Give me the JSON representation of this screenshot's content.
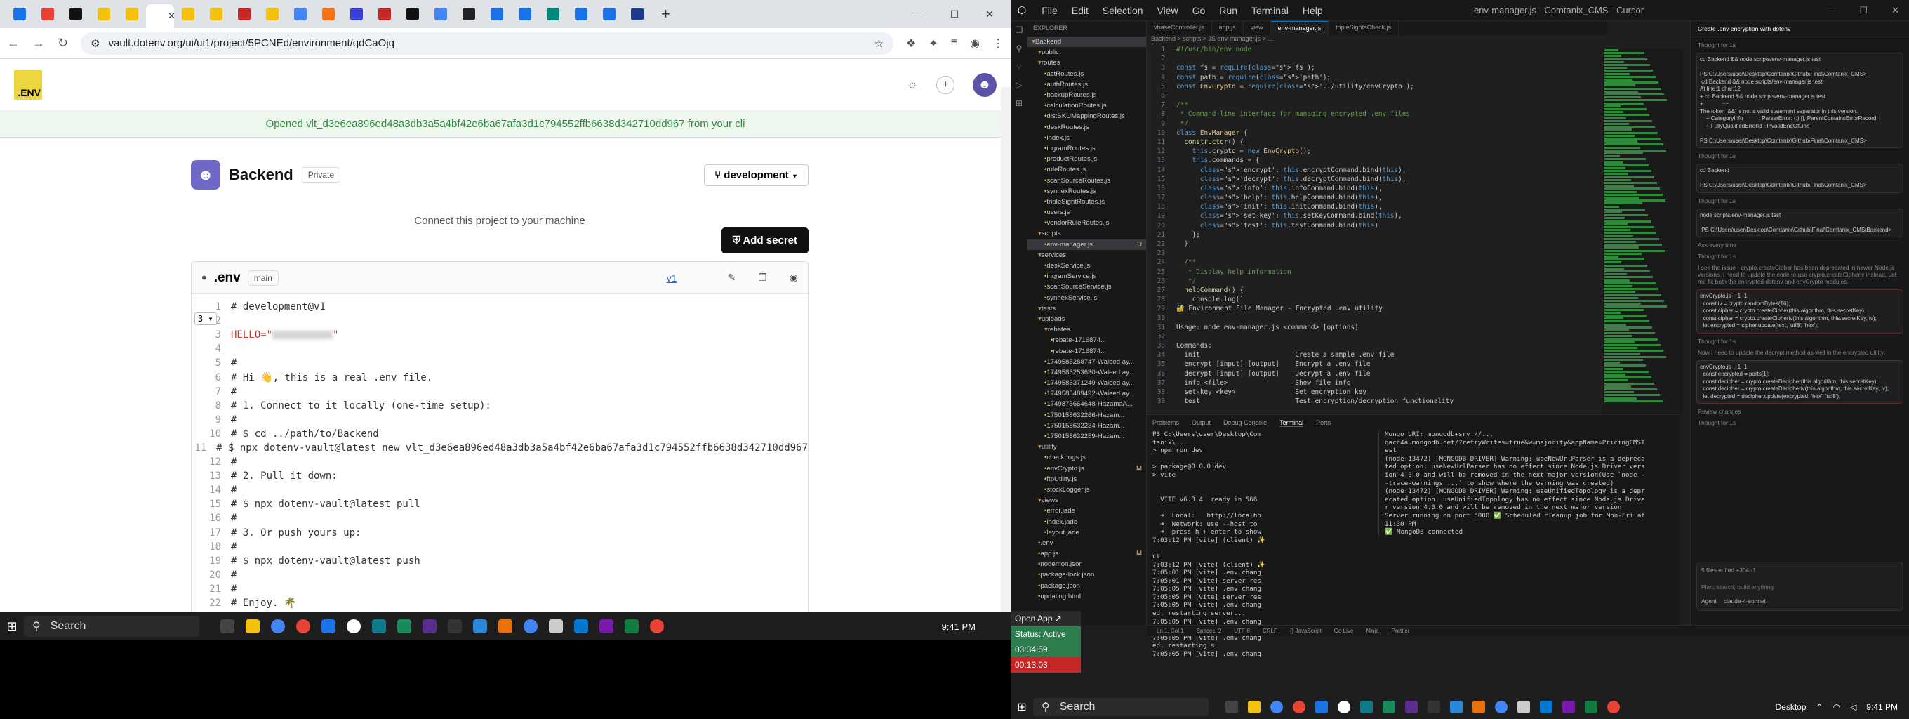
{
  "browser": {
    "tab_colors": [
      "#1a73e8",
      "#ea4335",
      "#111111",
      "#f4c20d",
      "#f4c20d",
      "#ffffff",
      "#f4c20d",
      "#f4c20d",
      "#c62828",
      "#f4c20d",
      "#4285f4",
      "#f97316",
      "#3b3fd8",
      "#c62828",
      "#111111",
      "#4285f4",
      "#222222",
      "#1a73e8",
      "#1a73e8",
      "#00897b",
      "#1a73e8",
      "#1a73e8",
      "#1e3a8a"
    ],
    "url": "vault.dotenv.org/ui/ui1/project/5PCNEd/environment/qdCaOjq"
  },
  "app": {
    "logo_text": ".ENV",
    "banner": "Opened vlt_d3e6ea896ed48a3db3a5a4bf42e6ba67afa3d1c794552ffb6638d342710dd967 from your cli",
    "project_name": "Backend",
    "visibility": "Private",
    "environment": "development",
    "connect_link": "Connect this project",
    "connect_suffix": " to your machine",
    "add_secret": "Add secret",
    "file_name": ".env",
    "branch": "main",
    "version": "v1",
    "fold_label": "3"
  },
  "env_lines": [
    {
      "no": "1",
      "text": "# development@v1"
    },
    {
      "no": "2",
      "text": ""
    },
    {
      "no": "3",
      "text": "HELLO=\"",
      "secret": true
    },
    {
      "no": "4",
      "text": ""
    },
    {
      "no": "5",
      "text": "#"
    },
    {
      "no": "6",
      "text": "# Hi 👋, this is a real .env file."
    },
    {
      "no": "7",
      "text": "#"
    },
    {
      "no": "8",
      "text": "# 1. Connect to it locally (one-time setup):"
    },
    {
      "no": "9",
      "text": "#"
    },
    {
      "no": "10",
      "text": "# $ cd ../path/to/Backend"
    },
    {
      "no": "11",
      "text": "# $ npx dotenv-vault@latest new vlt_d3e6ea896ed48a3db3a5a4bf42e6ba67afa3d1c794552ffb6638d342710dd967"
    },
    {
      "no": "12",
      "text": "#"
    },
    {
      "no": "13",
      "text": "# 2. Pull it down:"
    },
    {
      "no": "14",
      "text": "#"
    },
    {
      "no": "15",
      "text": "# $ npx dotenv-vault@latest pull"
    },
    {
      "no": "16",
      "text": "#"
    },
    {
      "no": "17",
      "text": "# 3. Or push yours up:"
    },
    {
      "no": "18",
      "text": "#"
    },
    {
      "no": "19",
      "text": "# $ npx dotenv-vault@latest push"
    },
    {
      "no": "20",
      "text": "#"
    },
    {
      "no": "21",
      "text": "#"
    },
    {
      "no": "22",
      "text": "# Enjoy. 🌴"
    }
  ],
  "taskbar_left": {
    "search": "Search",
    "clock": "9:41 PM"
  },
  "ide": {
    "menu": [
      "File",
      "Edit",
      "Selection",
      "View",
      "Go",
      "Run",
      "Terminal",
      "Help"
    ],
    "title": "env-manager.js - Comtanix_CMS - Cursor",
    "tabs": [
      "vbaseController.js",
      "app.js",
      "view",
      "env-manager.js",
      "tripleSightsCheck.js"
    ],
    "breadcrumb": "Backend > scripts > JS env-manager.js > ...",
    "explorer": [
      {
        "t": "Backend",
        "d": 0,
        "sel": true
      },
      {
        "t": "public",
        "d": 1
      },
      {
        "t": "routes",
        "d": 1
      },
      {
        "t": "actRoutes.js",
        "d": 2
      },
      {
        "t": "authRoutes.js",
        "d": 2
      },
      {
        "t": "backupRoutes.js",
        "d": 2
      },
      {
        "t": "calculationRoutes.js",
        "d": 2
      },
      {
        "t": "distSKUMappingRoutes.js",
        "d": 2
      },
      {
        "t": "deskRoutes.js",
        "d": 2
      },
      {
        "t": "index.js",
        "d": 2
      },
      {
        "t": "ingramRoutes.js",
        "d": 2
      },
      {
        "t": "productRoutes.js",
        "d": 2
      },
      {
        "t": "ruleRoutes.js",
        "d": 2
      },
      {
        "t": "scanSourceRoutes.js",
        "d": 2
      },
      {
        "t": "synnexRoutes.js",
        "d": 2
      },
      {
        "t": "tripleSightRoutes.js",
        "d": 2
      },
      {
        "t": "users.js",
        "d": 2
      },
      {
        "t": "vendorRuleRoutes.js",
        "d": 2
      },
      {
        "t": "scripts",
        "d": 1
      },
      {
        "t": "env-manager.js",
        "d": 2,
        "sel": true,
        "m": "U"
      },
      {
        "t": "services",
        "d": 1
      },
      {
        "t": "deskService.js",
        "d": 2
      },
      {
        "t": "ingramService.js",
        "d": 2
      },
      {
        "t": "scanSourceService.js",
        "d": 2
      },
      {
        "t": "synnexService.js",
        "d": 2
      },
      {
        "t": "tests",
        "d": 1
      },
      {
        "t": "uploads",
        "d": 1
      },
      {
        "t": "rebates",
        "d": 2
      },
      {
        "t": "rebate-1716874...",
        "d": 3
      },
      {
        "t": "rebate-1716874...",
        "d": 3
      },
      {
        "t": "1749585288747-Waleed ay...",
        "d": 2
      },
      {
        "t": "1749585253630-Waleed ay...",
        "d": 2
      },
      {
        "t": "1749585371249-Waleed ay...",
        "d": 2
      },
      {
        "t": "1749585489492-Waleed ay...",
        "d": 2
      },
      {
        "t": "1749875664648-HazamaA...",
        "d": 2
      },
      {
        "t": "1750158632266-Hazam...",
        "d": 2
      },
      {
        "t": "1750158632234-Hazam...",
        "d": 2
      },
      {
        "t": "1750158632259-Hazam...",
        "d": 2
      },
      {
        "t": "utility",
        "d": 1
      },
      {
        "t": "checkLogs.js",
        "d": 2
      },
      {
        "t": "envCrypto.js",
        "d": 2,
        "m": "M"
      },
      {
        "t": "ftpUtility.js",
        "d": 2
      },
      {
        "t": "stockLogger.js",
        "d": 2
      },
      {
        "t": "views",
        "d": 1
      },
      {
        "t": "error.jade",
        "d": 2
      },
      {
        "t": "index.jade",
        "d": 2
      },
      {
        "t": "layout.jade",
        "d": 2
      },
      {
        "t": ".env",
        "d": 1
      },
      {
        "t": "app.js",
        "d": 1,
        "m": "M"
      },
      {
        "t": "nodemon.json",
        "d": 1
      },
      {
        "t": "package-lock.json",
        "d": 1
      },
      {
        "t": "package.json",
        "d": 1
      },
      {
        "t": "updating.html",
        "d": 1
      }
    ],
    "code": [
      "#!/usr/bin/env node",
      "",
      "const fs = require('fs');",
      "const path = require('path');",
      "const EnvCrypto = require('../utility/envCrypto');",
      "",
      "/**",
      " * Command-line interface for managing encrypted .env files",
      " */",
      "class EnvManager {",
      "  constructor() {",
      "    this.crypto = new EnvCrypto();",
      "    this.commands = {",
      "      'encrypt': this.encryptCommand.bind(this),",
      "      'decrypt': this.decryptCommand.bind(this),",
      "      'info': this.infoCommand.bind(this),",
      "      'help': this.helpCommand.bind(this),",
      "      'init': this.initCommand.bind(this),",
      "      'set-key': this.setKeyCommand.bind(this),",
      "      'test': this.testCommand.bind(this)",
      "    };",
      "  }",
      "",
      "  /**",
      "   * Display help information",
      "   */",
      "  helpCommand() {",
      "    console.log(`",
      "🔐 Environment File Manager - Encrypted .env utility",
      "",
      "Usage: node env-manager.js <command> [options]",
      "",
      "Commands:",
      "  init                        Create a sample .env file",
      "  encrypt [input] [output]    Encrypt a .env file",
      "  decrypt [input] [output]    Decrypt a .env file",
      "  info <file>                 Show file info",
      "  set-key <key>               Set encryption key",
      "  test                        Test encryption/decryption functionality"
    ],
    "panel_tabs": [
      "Problems",
      "Output",
      "Debug Console",
      "Terminal",
      "Ports"
    ],
    "term_left": "PS C:\\Users\\user\\Desktop\\Com\ntanix\\...\n> npm run dev\n\n> package@0.0.0 dev\n> vite\n\n\n  VITE v6.3.4  ready in 566 \n\n  ➜  Local:   http://localho\n  ➜  Network: use --host to\n  ➜  press h + enter to show\n7:03:12 PM [vite] (client) ✨\n\nct\n7:03:12 PM [vite] (client) ✨\n7:05:01 PM [vite] .env chang\n7:05:01 PM [vite] server res\n7:05:05 PM [vite] .env chang\n7:05:05 PM [vite] server res\n7:05:05 PM [vite] .env chang\ned, restarting server...\n7:05:05 PM [vite] .env chang\ned, restarting server...\n7:05:05 PM [vite] .env chang\ned, restarting s\n7:05:05 PM [vite] .env chang",
    "term_right": "Mongo URI: mongodb+srv://...\nqacc4a.mongodb.net/?retryWrites=true&w=majority&appName=PricingCMST\nest\n(node:13472) [MONGODB DRIVER] Warning: useNewUrlParser is a depreca\nted option: useNewUrlParser has no effect since Node.js Driver vers\nion 4.0.0 and will be removed in the next major version(Use `node -\n-trace-warnings ...` to show where the warning was created)\n(node:13472) [MONGODB DRIVER] Warning: useUnifiedTopology is a depr\necated option: useUnifiedTopology has no effect since Node.js Drive\nr version 4.0.0 and will be removed in the next major version\nServer running on port 5000 ✅ Scheduled cleanup job for Mon-Fri at\n11:30 PM\n✅ MongoDB connected\n",
    "chat_title": "Create .env encryption with dotenv",
    "chat_blocks": [
      "cd Backend && node scripts/env-manager.js test\n\nPS C:\\Users\\user\\Desktop\\Comtanix\\Github\\Final\\Comtanix_CMS>\n cd Backend && node scripts/env-manager.js test\nAt line:1 char:12\n+ cd Backend && node scripts/env-manager.js test\n+            ~~\nThe token '&&' is not a valid statement separator in this version.\n    + CategoryInfo          : ParserError: (:) [], ParentContainsErrorRecord\n    + FullyQualifiedErrorId : InvalidEndOfLine\n\nPS C:\\Users\\user\\Desktop\\Comtanix\\Github\\Final\\Comtanix_CMS>",
      "cd Backend\n\nPS C:\\Users\\user\\Desktop\\Comtanix\\Github\\Final\\Comtanix_CMS>",
      "node scripts/env-manager.js test\n\n PS C:\\Users\\user\\Desktop\\Comtanix\\Github\\Final\\Comtanix_CMS\\Backend>"
    ],
    "chat_thoughts": [
      "Thought for 1s",
      "Thought for 1s",
      "Thought for 1s",
      "Thought for 1s",
      "Ask every time",
      "Thought for 1s",
      "I see the issue - crypto.createCipher has been deprecated in newer\nNode.js versions. I need to update the code to use crypto.createCipheriv\ninstead. Let me fix both the encrypted dotenv and envCrypto\nmodules.",
      "Thought for 1s",
      "Now I need to update the decrypt method as well in the encrypted\nutility:",
      "Review changes"
    ],
    "chat_diffs": [
      "envCrypto.js  +1 -1\n  const iv = crypto.randomBytes(16);\n  const cipher = crypto.createCipher(this.algorithm, this.secretKey);\n  const cipher = crypto.createCipheriv(this.algorithm, this.secretKey, iv);\n  let encrypted = cipher.update(text, 'utf8', 'hex');",
      "envCrypto.js  +1 -1\n  const encrypted = parts[1];\n  const decipher = crypto.createDecipher(this.algorithm, this.secretKey);\n  const decipher = crypto.createDecipheriv(this.algorithm, this.secretKey, iv);\n  let decrypted = decipher.update(encrypted, 'hex', 'utf8');"
    ],
    "chat_input": "Plan, search, build anything",
    "chat_footer": "5 files edited  +304  -1",
    "agent_mode": "Agent",
    "model": "claude-4-sonnet",
    "status": [
      "Ln 1, Col 1",
      "Spaces: 2",
      "UTF-8",
      "CRLF",
      "{} JavaScript",
      "Go Live",
      "Ninja",
      "Prettier"
    ],
    "widgets": [
      {
        "text": "Open App ↗",
        "color": "#2b2b2b"
      },
      {
        "text": "Status: Active",
        "color": "#2e7d4f"
      },
      {
        "text": "03:34:59",
        "color": "#2e7d4f"
      },
      {
        "text": "00:13:03",
        "color": "#c62828"
      }
    ]
  },
  "taskbar_right": {
    "search": "Search",
    "desktop": "Desktop",
    "clock": "9:41 PM"
  }
}
